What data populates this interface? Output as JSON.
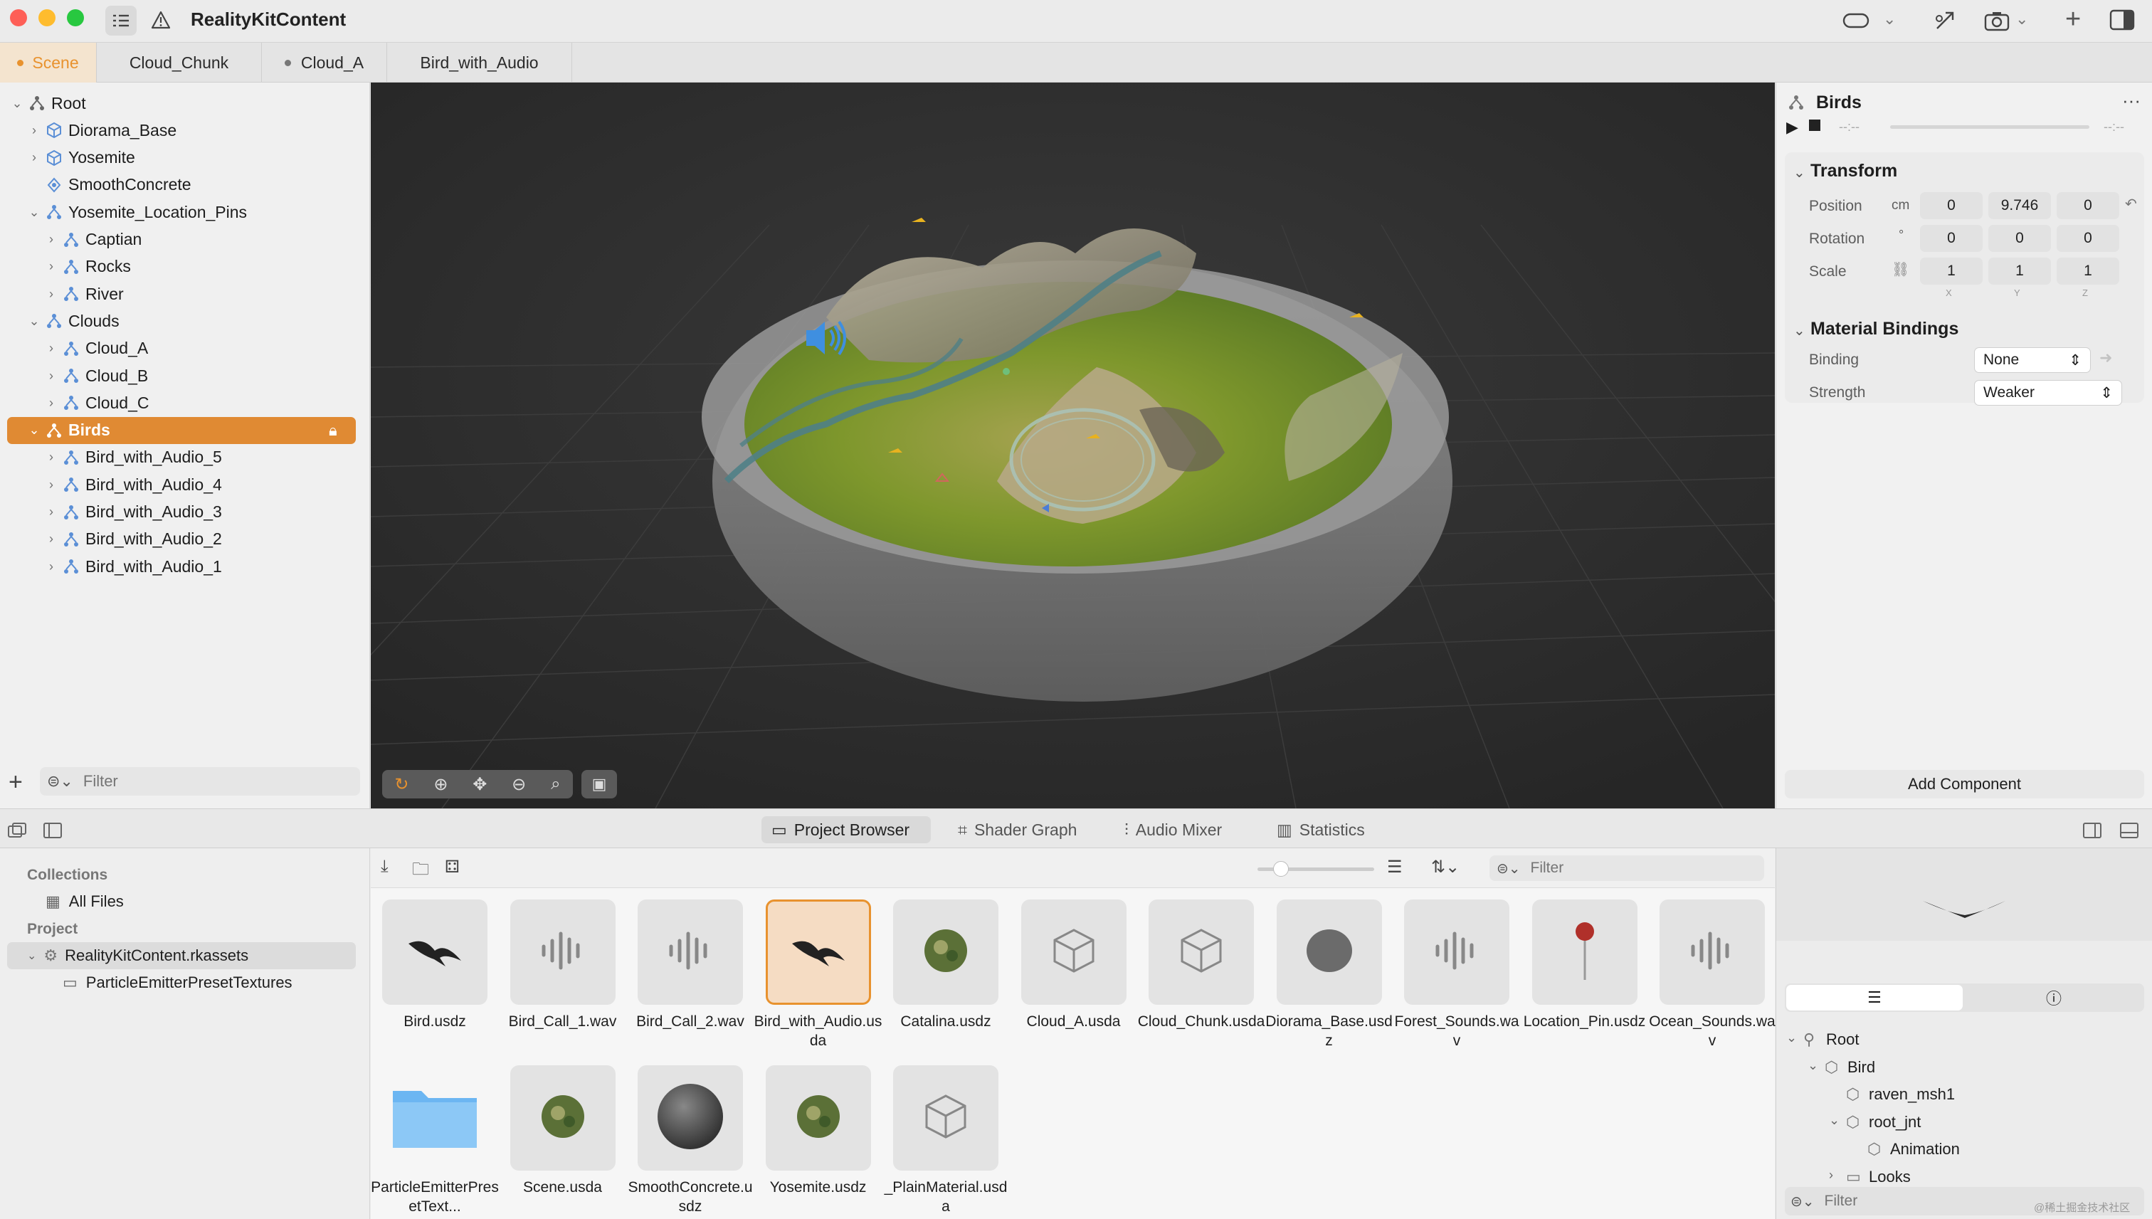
{
  "window": {
    "title": "RealityKitContent"
  },
  "tabs": [
    {
      "label": "Scene"
    },
    {
      "label": "Cloud_Chunk"
    },
    {
      "label": "Cloud_A"
    },
    {
      "label": "Bird_with_Audio"
    }
  ],
  "hierarchy": {
    "items": [
      {
        "label": "Root"
      },
      {
        "label": "Diorama_Base"
      },
      {
        "label": "Yosemite"
      },
      {
        "label": "SmoothConcrete"
      },
      {
        "label": "Yosemite_Location_Pins"
      },
      {
        "label": "Captian"
      },
      {
        "label": "Rocks"
      },
      {
        "label": "River"
      },
      {
        "label": "Clouds"
      },
      {
        "label": "Cloud_A"
      },
      {
        "label": "Cloud_B"
      },
      {
        "label": "Cloud_C"
      },
      {
        "label": "Birds"
      },
      {
        "label": "Bird_with_Audio_5"
      },
      {
        "label": "Bird_with_Audio_4"
      },
      {
        "label": "Bird_with_Audio_3"
      },
      {
        "label": "Bird_with_Audio_2"
      },
      {
        "label": "Bird_with_Audio_1"
      }
    ],
    "filter_placeholder": "Filter"
  },
  "inspector": {
    "entity_name": "Birds",
    "time_start": "--:--",
    "time_end": "--:--",
    "transform": {
      "title": "Transform",
      "position_label": "Position",
      "unit": "cm",
      "position": [
        "0",
        "9.746",
        "0"
      ],
      "rotation_label": "Rotation",
      "rotation_unit": "°",
      "rotation": [
        "0",
        "0",
        "0"
      ],
      "scale_label": "Scale",
      "scale": [
        "1",
        "1",
        "1"
      ],
      "axes": [
        "X",
        "Y",
        "Z"
      ]
    },
    "material_bindings": {
      "title": "Material Bindings",
      "binding_label": "Binding",
      "binding_value": "None",
      "strength_label": "Strength",
      "strength_value": "Weaker"
    },
    "add_component": "Add Component"
  },
  "bottom_tabs": [
    {
      "label": "Project Browser"
    },
    {
      "label": "Shader Graph"
    },
    {
      "label": "Audio Mixer"
    },
    {
      "label": "Statistics"
    }
  ],
  "project_sidebar": {
    "collections_title": "Collections",
    "all_files": "All Files",
    "project_title": "Project",
    "bundle": "RealityKitContent.rkassets",
    "folder": "ParticleEmitterPresetTextures"
  },
  "browser": {
    "filter_placeholder": "Filter",
    "files": [
      {
        "name": "Bird.usdz",
        "icon": "bird-icon"
      },
      {
        "name": "Bird_Call_1.wav",
        "icon": "waveform-icon"
      },
      {
        "name": "Bird_Call_2.wav",
        "icon": "waveform-icon"
      },
      {
        "name": "Bird_with_Audio.usda",
        "icon": "bird-icon"
      },
      {
        "name": "Catalina.usdz",
        "icon": "island-icon"
      },
      {
        "name": "Cloud_A.usda",
        "icon": "cube-icon"
      },
      {
        "name": "Cloud_Chunk.usda",
        "icon": "cube-icon"
      },
      {
        "name": "Diorama_Base.usdz",
        "icon": "disc-icon"
      },
      {
        "name": "Forest_Sounds.wav",
        "icon": "waveform-icon"
      },
      {
        "name": "Location_Pin.usdz",
        "icon": "pin-icon"
      },
      {
        "name": "Ocean_Sounds.wav",
        "icon": "waveform-icon"
      },
      {
        "name": "ParticleEmitterPresetText...",
        "icon": "folder-icon"
      },
      {
        "name": "Scene.usda",
        "icon": "island-icon"
      },
      {
        "name": "SmoothConcrete.usdz",
        "icon": "sphere-icon"
      },
      {
        "name": "Yosemite.usdz",
        "icon": "island-icon"
      },
      {
        "name": "_PlainMaterial.usda",
        "icon": "cube-icon"
      }
    ]
  },
  "preview": {
    "tree": [
      {
        "label": "Root"
      },
      {
        "label": "Bird"
      },
      {
        "label": "raven_msh1"
      },
      {
        "label": "root_jnt"
      },
      {
        "label": "Animation"
      },
      {
        "label": "Looks"
      }
    ],
    "filter_placeholder": "Filter",
    "watermark": "@稀土掘金技术社区"
  },
  "colors": {
    "accent": "#e8922e",
    "selection": "#e08a33"
  }
}
